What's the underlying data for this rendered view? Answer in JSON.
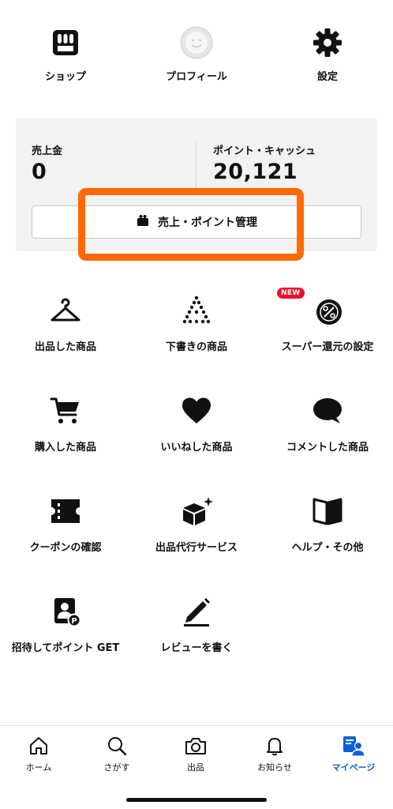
{
  "top": {
    "shop": "ショップ",
    "profile": "プロフィール",
    "settings": "設定"
  },
  "sales": {
    "sales_label": "売上金",
    "sales_value": "0",
    "points_label": "ポイント・キャッシュ",
    "points_value": "20,121",
    "manage_button": "売上・ポイント管理"
  },
  "menu": {
    "listed_items": "出品した商品",
    "drafts": "下書きの商品",
    "super_return": "スーパー還元の設定",
    "new_badge": "NEW",
    "purchased": "購入した商品",
    "liked": "いいねした商品",
    "commented": "コメントした商品",
    "coupons": "クーポンの確認",
    "listing_service": "出品代行サービス",
    "help": "ヘルプ・その他",
    "invite": "招待してポイント GET",
    "review": "レビューを書く"
  },
  "nav": {
    "home": "ホーム",
    "search": "さがす",
    "sell": "出品",
    "notifications": "お知らせ",
    "mypage": "マイページ"
  },
  "colors": {
    "highlight": "#ff6a00",
    "active_nav": "#0b62d6",
    "new_badge": "#e8112d",
    "card_bg": "#f2f2f2"
  }
}
